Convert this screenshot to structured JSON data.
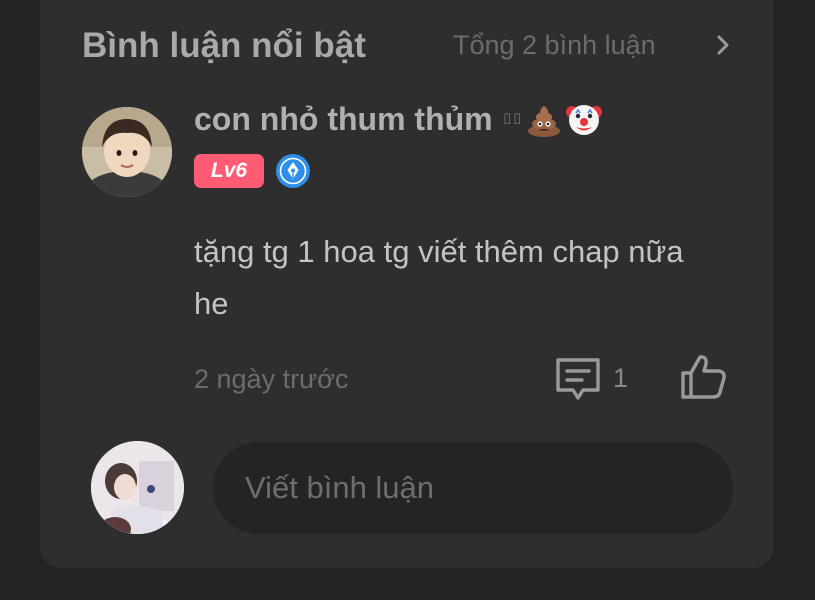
{
  "header": {
    "title": "Bình luận nổi bật",
    "total": "Tổng 2 bình luận"
  },
  "comment": {
    "username": "con nhỏ thum thủm",
    "username_unrendered_glyphs": "⌷⌷",
    "username_emojis": [
      "pile-of-poo-emoji",
      "clown-face-emoji"
    ],
    "level_badge": "Lv6",
    "text": "tặng tg 1 hoa tg viết thêm chap nữa he",
    "timestamp": "2 ngày trước",
    "reply_count": "1"
  },
  "composer": {
    "placeholder": "Viết bình luận"
  },
  "colors": {
    "background": "#232323",
    "card": "#2e2e2e",
    "level_badge": "#ff5c74",
    "pen_badge": "#2f8fe8"
  },
  "icons": [
    "chevron-right-icon",
    "pen-badge-icon",
    "reply-icon",
    "like-icon"
  ]
}
